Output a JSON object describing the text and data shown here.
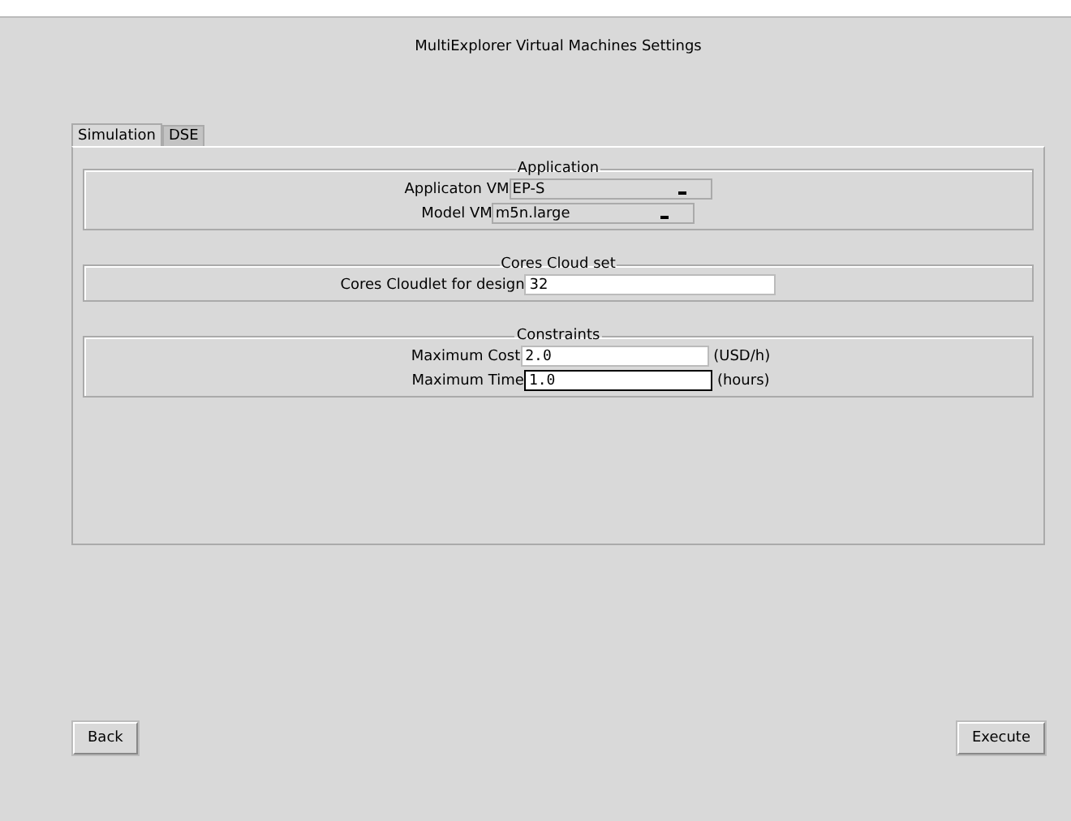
{
  "window": {
    "title": "MultiExplorer Virtual Machines Settings"
  },
  "tabs": [
    {
      "label": "Simulation",
      "selected": true
    },
    {
      "label": "DSE",
      "selected": false
    }
  ],
  "groups": [
    {
      "title": "Application",
      "fields": [
        {
          "kind": "combo",
          "label": "Applicaton VM",
          "value": "EP-S",
          "focused": false
        },
        {
          "kind": "combo",
          "label": "Model VM",
          "value": "m5n.large",
          "focused": false
        }
      ]
    },
    {
      "title": "Cores Cloud set",
      "fields": [
        {
          "kind": "entry",
          "label": "Cores Cloudlet for design",
          "value": "32",
          "focused": false
        }
      ]
    },
    {
      "title": "Constraints",
      "fields": [
        {
          "kind": "entry",
          "label": "Maximum Cost",
          "value": "2.0",
          "unit": "(USD/h)",
          "focused": false
        },
        {
          "kind": "entry",
          "label": "Maximum Time",
          "value": "1.0",
          "unit": "(hours)",
          "focused": true
        }
      ]
    }
  ],
  "buttons": [
    {
      "label": "Back"
    },
    {
      "label": "Execute"
    }
  ]
}
